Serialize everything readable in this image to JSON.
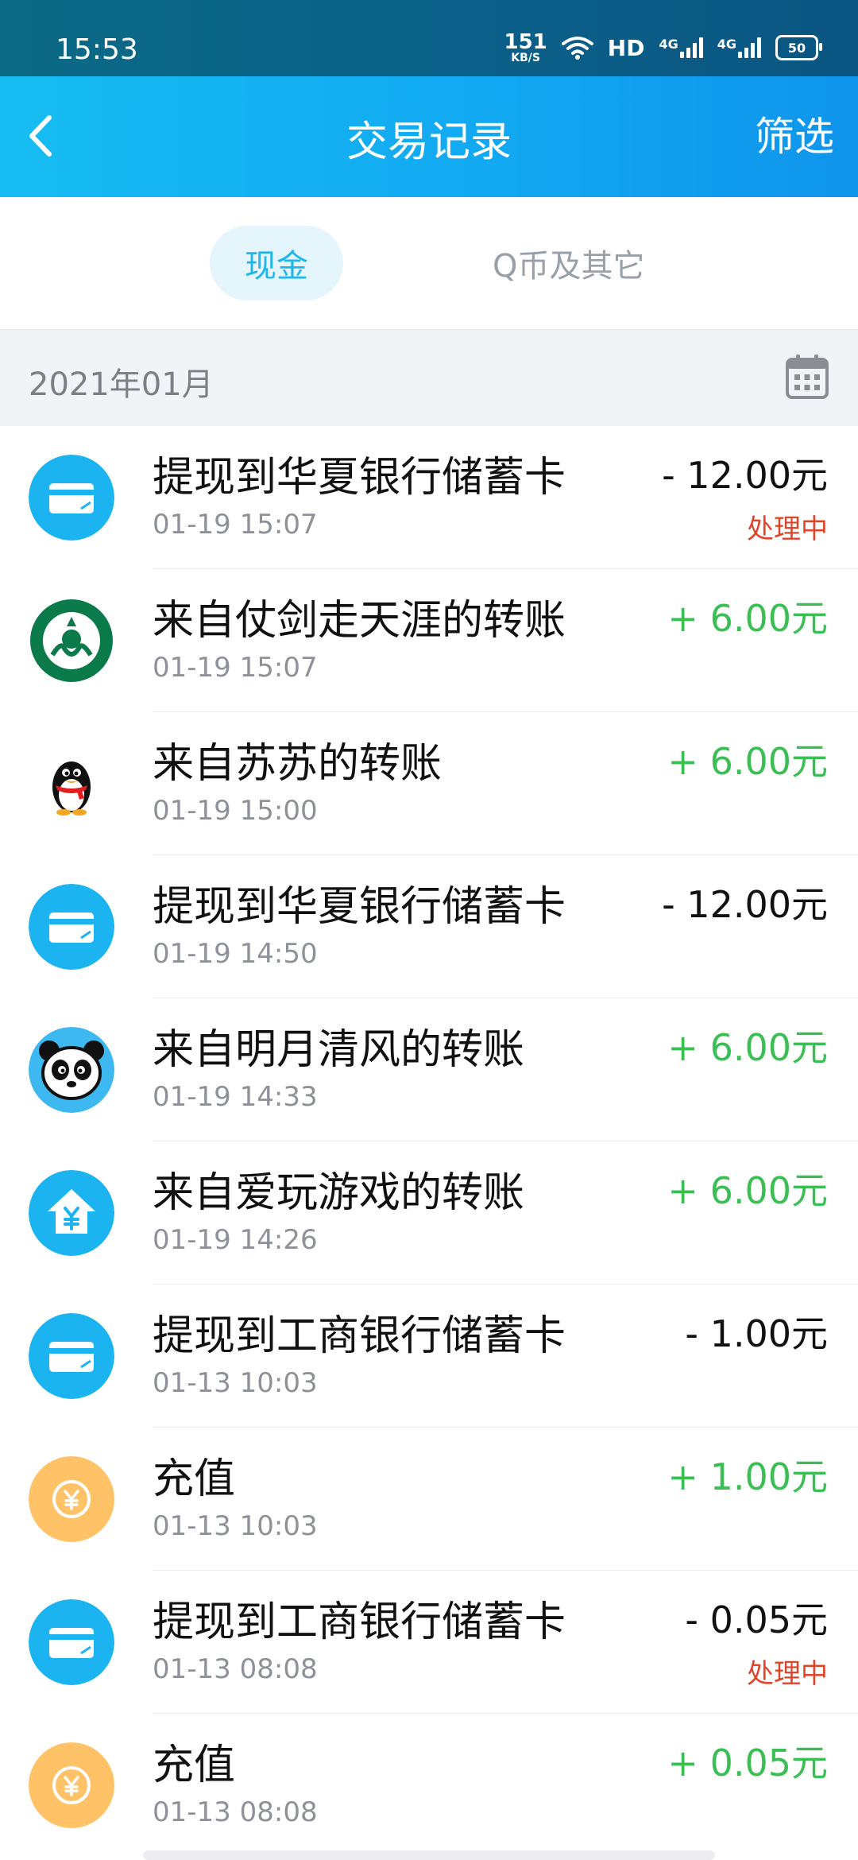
{
  "status_bar": {
    "time": "15:53",
    "net_speed": "151",
    "net_speed_unit": "KB/S",
    "hd_label": "HD",
    "sim1_label": "4G",
    "sim2_label": "4G",
    "battery": "50"
  },
  "nav": {
    "title": "交易记录",
    "filter_label": "筛选"
  },
  "tabs": {
    "cash": "现金",
    "qcoin_other": "Q币及其它"
  },
  "month": "2021年01月",
  "colors": {
    "header_blue": "#12a9f2",
    "positive": "#3bbf55",
    "negative": "#111111",
    "processing": "#e0452a",
    "card_icon_bg": "#1bb4f0",
    "coin_icon_bg": "#ffc266"
  },
  "transactions": [
    {
      "icon": "bank-card-icon",
      "title": "提现到华夏银行储蓄卡",
      "time": "01-19 15:07",
      "amount": "- 12.00元",
      "type": "neg",
      "status": "处理中"
    },
    {
      "icon": "starbucks-avatar-icon",
      "title": "来自仗剑走天涯的转账",
      "time": "01-19 15:07",
      "amount": "+ 6.00元",
      "type": "pos",
      "status": ""
    },
    {
      "icon": "qq-penguin-avatar-icon",
      "title": "来自苏苏的转账",
      "time": "01-19 15:00",
      "amount": "+ 6.00元",
      "type": "pos",
      "status": ""
    },
    {
      "icon": "bank-card-icon",
      "title": "提现到华夏银行储蓄卡",
      "time": "01-19 14:50",
      "amount": "- 12.00元",
      "type": "neg",
      "status": ""
    },
    {
      "icon": "panda-avatar-icon",
      "title": "来自明月清风的转账",
      "time": "01-19 14:33",
      "amount": "+ 6.00元",
      "type": "pos",
      "status": ""
    },
    {
      "icon": "home-yen-icon",
      "title": "来自爱玩游戏的转账",
      "time": "01-19 14:26",
      "amount": "+ 6.00元",
      "type": "pos",
      "status": ""
    },
    {
      "icon": "bank-card-icon",
      "title": "提现到工商银行储蓄卡",
      "time": "01-13 10:03",
      "amount": "- 1.00元",
      "type": "neg",
      "status": ""
    },
    {
      "icon": "yen-coin-icon",
      "title": "充值",
      "time": "01-13 10:03",
      "amount": "+ 1.00元",
      "type": "pos",
      "status": ""
    },
    {
      "icon": "bank-card-icon",
      "title": "提现到工商银行储蓄卡",
      "time": "01-13 08:08",
      "amount": "- 0.05元",
      "type": "neg",
      "status": "处理中"
    },
    {
      "icon": "yen-coin-icon",
      "title": "充值",
      "time": "01-13 08:08",
      "amount": "+ 0.05元",
      "type": "pos",
      "status": ""
    }
  ]
}
